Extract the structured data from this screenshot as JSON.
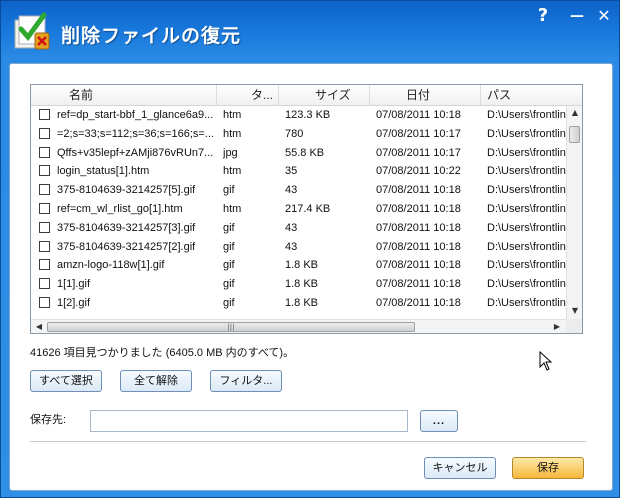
{
  "window": {
    "title": "削除ファイルの復元",
    "help": "?",
    "minimize": "—",
    "close": "✕"
  },
  "columns": [
    "名前",
    "タ...",
    "サイズ",
    "日付",
    "パス"
  ],
  "files": [
    {
      "name": "ref=dp_start-bbf_1_glance6a9...",
      "type": "htm",
      "size": "123.3 KB",
      "date": "07/08/2011 10:18",
      "path": "D:\\Users\\frontline"
    },
    {
      "name": "=2;s=33;s=112;s=36;s=166;s=...",
      "type": "htm",
      "size": "780",
      "date": "07/08/2011 10:17",
      "path": "D:\\Users\\frontline"
    },
    {
      "name": "Qffs+v35lepf+zAMji876vRUn7...",
      "type": "jpg",
      "size": "55.8 KB",
      "date": "07/08/2011 10:17",
      "path": "D:\\Users\\frontline"
    },
    {
      "name": "login_status[1].htm",
      "type": "htm",
      "size": "35",
      "date": "07/08/2011 10:22",
      "path": "D:\\Users\\frontline"
    },
    {
      "name": "375-8104639-3214257[5].gif",
      "type": "gif",
      "size": "43",
      "date": "07/08/2011 10:18",
      "path": "D:\\Users\\frontline"
    },
    {
      "name": "ref=cm_wl_rlist_go[1].htm",
      "type": "htm",
      "size": "217.4 KB",
      "date": "07/08/2011 10:18",
      "path": "D:\\Users\\frontline"
    },
    {
      "name": "375-8104639-3214257[3].gif",
      "type": "gif",
      "size": "43",
      "date": "07/08/2011 10:18",
      "path": "D:\\Users\\frontline"
    },
    {
      "name": "375-8104639-3214257[2].gif",
      "type": "gif",
      "size": "43",
      "date": "07/08/2011 10:18",
      "path": "D:\\Users\\frontline"
    },
    {
      "name": "amzn-logo-118w[1].gif",
      "type": "gif",
      "size": "1.8 KB",
      "date": "07/08/2011 10:18",
      "path": "D:\\Users\\frontline"
    },
    {
      "name": "1[1].gif",
      "type": "gif",
      "size": "1.8 KB",
      "date": "07/08/2011 10:18",
      "path": "D:\\Users\\frontline"
    },
    {
      "name": "1[2].gif",
      "type": "gif",
      "size": "1.8 KB",
      "date": "07/08/2011 10:18",
      "path": "D:\\Users\\frontline"
    }
  ],
  "status": "41626 項目見つかりました (6405.0 MB 内のすべて)。",
  "buttons": {
    "select_all": "すべて選択",
    "deselect_all": "全て解除",
    "filter": "フィルタ...",
    "browse": "...",
    "cancel": "キャンセル",
    "save": "保存"
  },
  "save_to": {
    "label": "保存先:",
    "value": ""
  }
}
